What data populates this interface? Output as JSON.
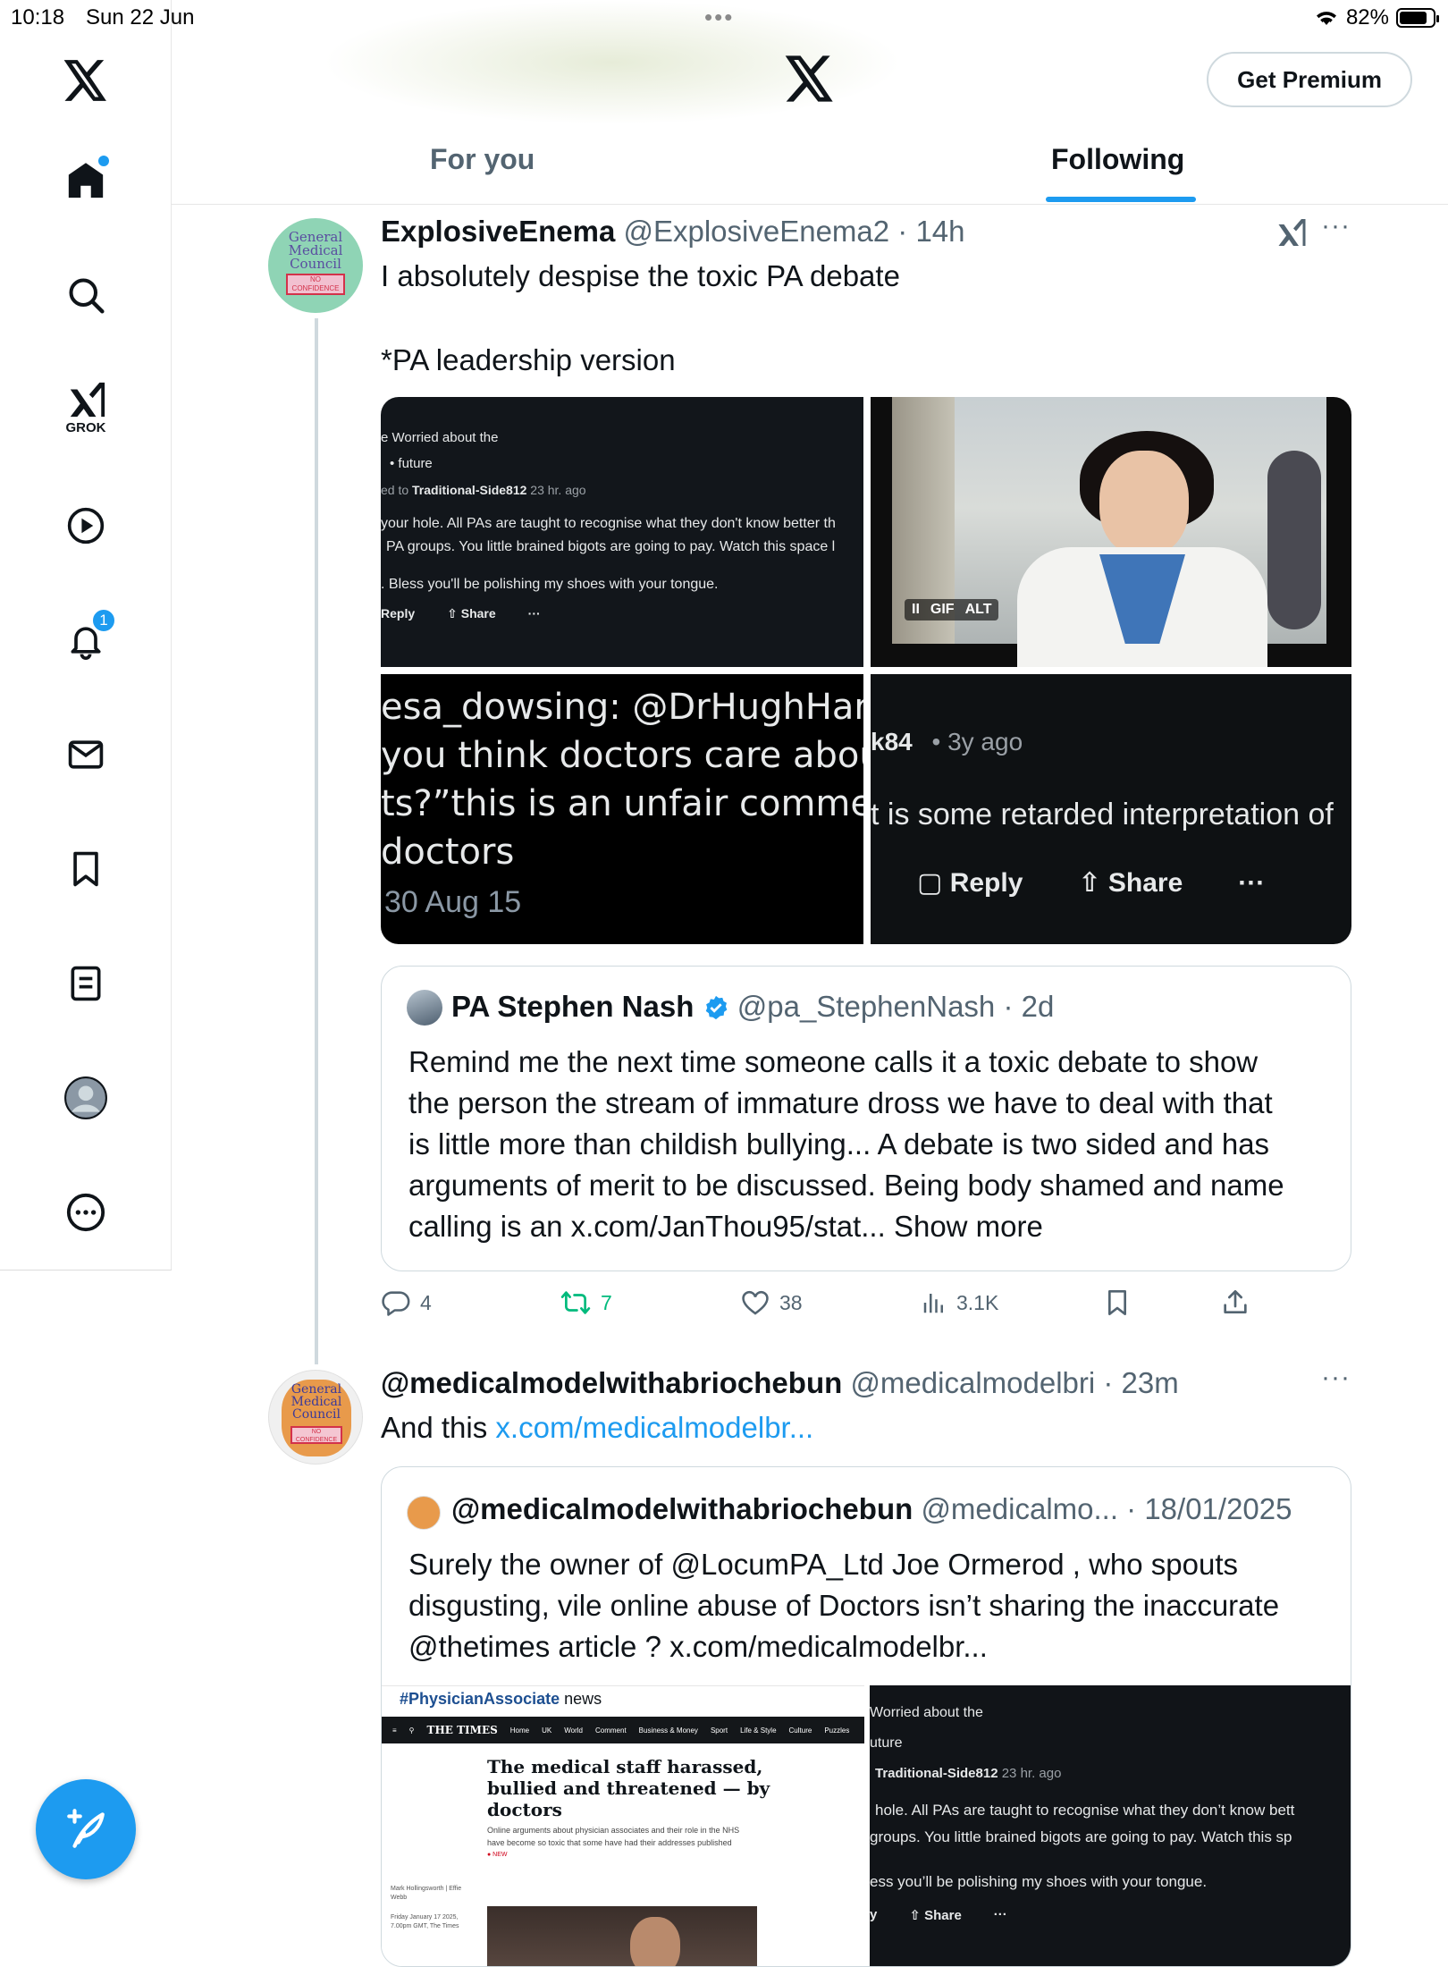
{
  "status_bar": {
    "time": "10:18",
    "date": "Sun 22 Jun",
    "dots": "•••",
    "battery": "82%",
    "battery_level": 0.82
  },
  "header": {
    "premium_label": "Get Premium"
  },
  "tabs": [
    {
      "label": "For you"
    },
    {
      "label": "Following"
    }
  ],
  "sidebar": {
    "items": [
      {
        "icon": "x-logo-icon"
      },
      {
        "icon": "home-icon"
      },
      {
        "icon": "search-icon"
      },
      {
        "icon": "grok-icon",
        "label": "GROK"
      },
      {
        "icon": "play-icon"
      },
      {
        "icon": "bell-icon",
        "badge": "1"
      },
      {
        "icon": "mail-icon"
      },
      {
        "icon": "bookmark-icon"
      },
      {
        "icon": "list-icon"
      },
      {
        "icon": "profile-icon"
      },
      {
        "icon": "more-icon"
      }
    ]
  },
  "tweet1": {
    "name": "ExplosiveEnema",
    "handle": "@ExplosiveEnema2",
    "time": "· 14h",
    "line1": "I absolutely despise the toxic PA debate",
    "line2": "*PA leadership version",
    "avatar_text": {
      "l1": "General",
      "l2": "Medical",
      "l3": "Council",
      "l4": "NO CONFIDENCE"
    },
    "media": {
      "tl": {
        "r1": "e    Worried about the",
        "r2": "•  future",
        "r3a": "ed to ",
        "r3b": "Traditional-Side812",
        "r3c": " 23 hr. ago",
        "r4": "your hole. All PAs are taught to recognise what they don't know better th",
        "r5": "PA groups. You little brained bigots are going to pay. Watch this space l",
        "r6": ". Bless you'll be polishing my shoes with your tongue.",
        "reply": "Reply",
        "share": "Share",
        "dots": "···"
      },
      "tr": {
        "pause": "II",
        "gif": "GIF",
        "alt": "ALT"
      },
      "bl": {
        "l1": "esa_dowsing: @DrHughHarve",
        "l2": "you think doctors care about",
        "l3": "ts?”this is an unfair commen",
        "l4": " doctors",
        "l5": "30 Aug 15"
      },
      "br": {
        "user": "k84",
        "ago": "• 3y ago",
        "text": "t is some retarded interpretation of",
        "reply": "Reply",
        "share": "Share",
        "dots": "···"
      }
    },
    "quote": {
      "name": "PA Stephen Nash",
      "handle": "@pa_StephenNash",
      "time": "· 2d",
      "lines": [
        "Remind me the next time someone calls it a toxic debate to show",
        "the person the stream of immature dross we have to deal with that",
        "is little more than childish bullying... A debate is two sided and has",
        "arguments of merit to be discussed. Being body shamed and name",
        "calling is an x.com/JanThou95/stat..."
      ],
      "show_more": "Show more"
    },
    "actions": {
      "replies": "4",
      "reposts": "7",
      "likes": "38",
      "views": "3.1K"
    }
  },
  "tweet2": {
    "name": "@medicalmodelwithabriochebun",
    "handle": "@medicalmodelbri",
    "time": "· 23m",
    "text": "And this ",
    "link": "x.com/medicalmodelbr...",
    "avatar_text": {
      "l1": "General",
      "l2": "Medical",
      "l3": "Council",
      "l4": "NO CONFIDENCE"
    },
    "quote": {
      "name": "@medicalmodelwithabriochebun",
      "handle": "@medicalmo...",
      "time": "· 18/01/2025",
      "lines": [
        "Surely the owner of @LocumPA_Ltd Joe Ormerod ,  who spouts",
        "disgusting, vile online abuse of Doctors isn’t sharing the inaccurate",
        "@thetimes article  ? x.com/medicalmodelbr..."
      ],
      "media_left": {
        "tag": "#PhysicianAssociate",
        "tag_suffix": " news",
        "paper": "THE TIMES",
        "nav": [
          "Home",
          "UK",
          "World",
          "Comment",
          "Business & Money",
          "Sport",
          "Life & Style",
          "Culture",
          "Puzzles"
        ],
        "headline1": "The medical staff harassed,",
        "headline2": "bullied and threatened — by",
        "headline3": "doctors",
        "sub1": "Online arguments about physician associates and their role in the NHS",
        "sub2": "have become so toxic that some have had their addresses published",
        "new_tag": "● NEW",
        "byline1": "Mark Hollingsworth | Effie",
        "byline2": "Webb",
        "date1": "Friday January 17 2025,",
        "date2": "7.00pm GMT, The Times"
      },
      "media_right": {
        "r1": "Worried about the",
        "r2": "uture",
        "r3a": "Traditional-Side812",
        "r3b": " 23 hr. ago",
        "r4": "hole. All PAs are taught to recognise what they don’t know bett",
        "r5": "groups. You little brained bigots are going to pay. Watch this sp",
        "r6": "ess you’ll be polishing my shoes with your tongue.",
        "share": "Share",
        "dots": "···",
        "y": "y"
      }
    }
  },
  "colors": {
    "accent": "#1d9bf0",
    "repost": "#00ba7c",
    "muted": "#536471"
  }
}
